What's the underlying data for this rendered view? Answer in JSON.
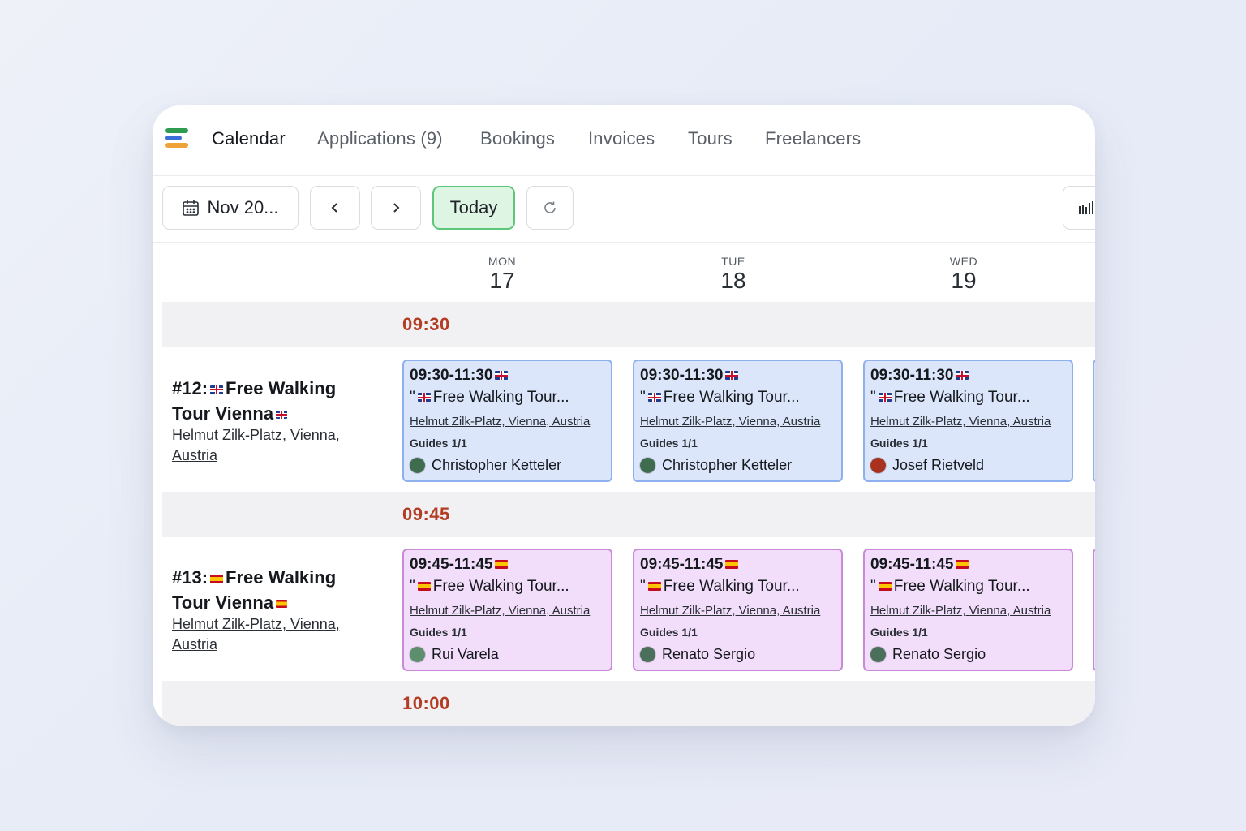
{
  "nav": {
    "tabs": [
      {
        "label": "Calendar",
        "active": true
      },
      {
        "label": "Applications (9)"
      },
      {
        "label": "Bookings"
      },
      {
        "label": "Invoices"
      },
      {
        "label": "Tours"
      },
      {
        "label": "Freelancers"
      }
    ]
  },
  "toolbar": {
    "date_label": "Nov 20...",
    "today_label": "Today"
  },
  "days": [
    {
      "name": "MON",
      "num": "17"
    },
    {
      "name": "TUE",
      "num": "18"
    },
    {
      "name": "WED",
      "num": "19"
    }
  ],
  "slots": [
    {
      "time": "09:30",
      "tour": {
        "title_prefix": "#12:",
        "flag": "uk",
        "title_a": "Free Walking",
        "title_b": "Tour Vienna",
        "address_a": "Helmut Zilk-Platz, Vienna,",
        "address_b": "Austria"
      },
      "cards": [
        {
          "time": "09:30-11:30",
          "flag": "uk",
          "name": "Free Walking Tour...",
          "address": "Helmut Zilk-Platz, Vienna, Austria",
          "guides": "Guides 1/1",
          "guide": "Christopher Ketteler",
          "avatar_color": "#3f6b4e"
        },
        {
          "time": "09:30-11:30",
          "flag": "uk",
          "name": "Free Walking Tour...",
          "address": "Helmut Zilk-Platz, Vienna, Austria",
          "guides": "Guides 1/1",
          "guide": "Christopher Ketteler",
          "avatar_color": "#3f6b4e"
        },
        {
          "time": "09:30-11:30",
          "flag": "uk",
          "name": "Free Walking Tour...",
          "address": "Helmut Zilk-Platz, Vienna, Austria",
          "guides": "Guides 1/1",
          "guide": "Josef Rietveld",
          "avatar_color": "#a8321f"
        }
      ]
    },
    {
      "time": "09:45",
      "tour": {
        "title_prefix": "#13:",
        "flag": "es",
        "title_a": "Free Walking",
        "title_b": "Tour Vienna",
        "address_a": "Helmut Zilk-Platz, Vienna,",
        "address_b": "Austria"
      },
      "cards": [
        {
          "time": "09:45-11:45",
          "flag": "es",
          "name": "Free Walking Tour...",
          "address": "Helmut Zilk-Platz, Vienna, Austria",
          "guides": "Guides 1/1",
          "guide": "Rui Varela",
          "avatar_color": "#5d8f6f"
        },
        {
          "time": "09:45-11:45",
          "flag": "es",
          "name": "Free Walking Tour...",
          "address": "Helmut Zilk-Platz, Vienna, Austria",
          "guides": "Guides 1/1",
          "guide": "Renato Sergio",
          "avatar_color": "#4a6f5a"
        },
        {
          "time": "09:45-11:45",
          "flag": "es",
          "name": "Free Walking Tour...",
          "address": "Helmut Zilk-Platz, Vienna, Austria",
          "guides": "Guides 1/1",
          "guide": "Renato Sergio",
          "avatar_color": "#4a6f5a"
        }
      ]
    }
  ],
  "next_time": "10:00",
  "colors": {
    "accent_time": "#b33c24",
    "blue_card": "#dbe6fb",
    "purple_card": "#f2defa",
    "today_green": "#5cc77a"
  }
}
